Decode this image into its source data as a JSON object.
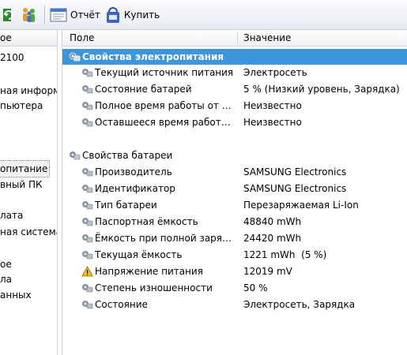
{
  "toolbar": {
    "report_label": "Отчёт",
    "buy_label": "Купить"
  },
  "left_panel": {
    "header_fragment": "ое",
    "items": [
      {
        "label": "2100",
        "selected": false
      },
      {
        "label": "ная информ",
        "selected": false
      },
      {
        "label": "пьютера",
        "selected": false
      },
      {
        "label": "опитание",
        "selected": true
      },
      {
        "label": "вный ПК",
        "selected": false
      },
      {
        "label": "лата",
        "selected": false
      },
      {
        "label": "ная система",
        "selected": false
      },
      {
        "label": "ое",
        "selected": false
      },
      {
        "label": "ла",
        "selected": false
      },
      {
        "label": "анных",
        "selected": false
      }
    ]
  },
  "table": {
    "col_field": "Поле",
    "col_value": "Значение",
    "power_group": {
      "title": "Свойства электропитания",
      "rows": [
        {
          "field": "Текущий источник питания",
          "value": "Электросеть"
        },
        {
          "field": "Состояние батарей",
          "value": "5 % (Низкий уровень, Зарядка)"
        },
        {
          "field": "Полное время работы от б...",
          "value": "Неизвестно"
        },
        {
          "field": "Оставшееся время работы ...",
          "value": "Неизвестно"
        }
      ]
    },
    "battery_group": {
      "title": "Свойства батареи",
      "rows": [
        {
          "field": "Производитель",
          "value": "SAMSUNG Electronics",
          "icon": "battery-icon"
        },
        {
          "field": "Идентификатор",
          "value": "SAMSUNG Electronics",
          "icon": "battery-icon"
        },
        {
          "field": "Тип батареи",
          "value": "Перезаряжаемая Li-Ion",
          "icon": "battery-icon"
        },
        {
          "field": "Паспортная ёмкость",
          "value": "48840 mWh",
          "icon": "battery-icon"
        },
        {
          "field": "Ёмкость при полной зарядке",
          "value": "24420 mWh",
          "icon": "battery-icon"
        },
        {
          "field": "Текущая ёмкость",
          "value": "1221 mWh  (5 %)",
          "icon": "battery-icon"
        },
        {
          "field": "Напряжение питания",
          "value": "12019 mV",
          "icon": "warning-icon"
        },
        {
          "field": "Степень изношенности",
          "value": "50 %",
          "icon": "battery-icon"
        },
        {
          "field": "Состояние",
          "value": "Электросеть, Зарядка",
          "icon": "battery-icon"
        }
      ]
    }
  },
  "colors": {
    "highlight": "#3d95dc",
    "toolbar_top": "#fbfbfd",
    "toolbar_bottom": "#e7ebf2"
  }
}
